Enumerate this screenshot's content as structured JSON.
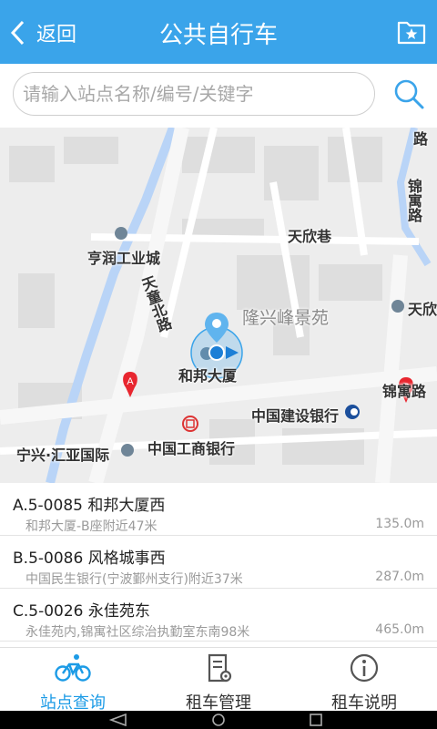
{
  "header": {
    "back_label": "返回",
    "title": "公共自行车"
  },
  "search": {
    "placeholder": "请输入站点名称/编号/关键字",
    "value": ""
  },
  "map": {
    "labels": {
      "tianxiang": "天欣巷",
      "hengrun": "亨润工业城",
      "longxing": "隆兴峰景苑",
      "tiantong": "天童北路",
      "hebang": "和邦大厦",
      "jinyu_v": "锦寓路",
      "jinyu_h": "锦寓路",
      "tianxin_cut": "天欣",
      "ccb": "中国建设银行",
      "icbc": "中国工商银行",
      "ningxing": "宁兴·汇亚国际",
      "lu_top": "路"
    },
    "markers": {
      "a": "A",
      "b": "B"
    }
  },
  "stations": [
    {
      "name": "A.5-0085 和邦大厦西",
      "address": "和邦大厦-B座附近47米",
      "distance": "135.0m"
    },
    {
      "name": "B.5-0086 风格城事西",
      "address": "中国民生银行(宁波鄞州支行)附近37米",
      "distance": "287.0m"
    },
    {
      "name": "C.5-0026 永佳苑东",
      "address": "永佳苑内,锦寓社区综治执勤室东南98米",
      "distance": "465.0m"
    }
  ],
  "tabs": [
    {
      "label": "站点查询",
      "icon": "bicycle-icon",
      "active": true
    },
    {
      "label": "租车管理",
      "icon": "document-gear-icon",
      "active": false
    },
    {
      "label": "租车说明",
      "icon": "info-icon",
      "active": false
    }
  ],
  "colors": {
    "primary": "#3aa4ea",
    "tab_active": "#1c9be6",
    "marker": "#e8262f"
  }
}
